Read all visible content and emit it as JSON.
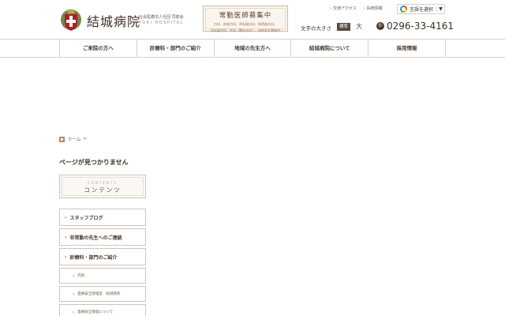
{
  "header": {
    "logo_name": "結城病院",
    "logo_sub_jp": "社会医療法人社団 同樹会",
    "logo_sub_en": "YUKI HOSPITAL",
    "recruit_title": "常勤医師募集中",
    "recruit_sub_1": "内科、神経内科、呼吸器内科、循環器内科、",
    "recruit_sub_2": "消化器内科、外科（整形外科）、研修医を募集中",
    "top_links": [
      "交通アクセス",
      "採用情報"
    ],
    "lang_label": "言語を選択",
    "lang_arrow": "▼",
    "font_size_label": "文字の大きさ",
    "font_std": "標準",
    "font_large": "大",
    "phone": "0296-33-4161"
  },
  "nav": {
    "items": [
      "ご来院の方へ",
      "診療科・部門のご紹介",
      "地域の先生方へ",
      "結城病院について",
      "採用情報"
    ]
  },
  "breadcrumb": {
    "home": "ホーム",
    "sep": ">"
  },
  "page_title": "ページが見つかりません",
  "contents": {
    "en": "CONTENTS",
    "jp": "コンテンツ"
  },
  "menu": {
    "items": [
      {
        "label": "スタッフブログ"
      },
      {
        "label": "非常勤の先生へのご連絡"
      },
      {
        "label": "診療科・部門のご紹介"
      },
      {
        "label": "内科"
      },
      {
        "label": "医療安全管理室　結城病院"
      },
      {
        "label": "医療安全管理について"
      }
    ]
  },
  "colors": {
    "accent": "#b7896a",
    "text": "#4a3a30",
    "border": "#cfc5bb"
  }
}
